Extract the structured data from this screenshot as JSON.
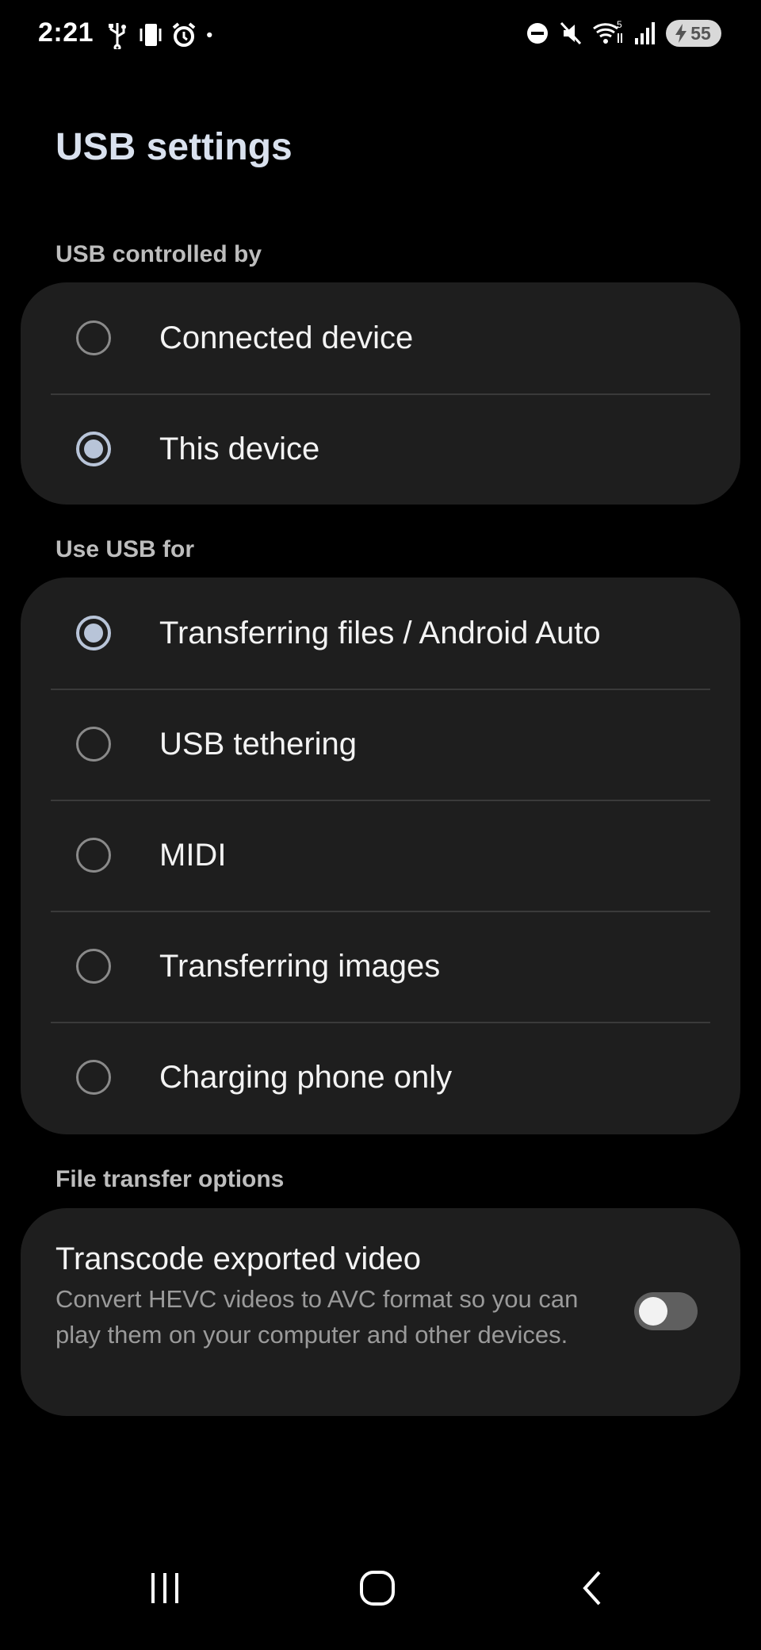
{
  "status": {
    "time": "2:21",
    "wifi_badge": "5",
    "battery_level": "55",
    "left_icons": [
      "usb-icon",
      "vibrate-icon",
      "alarm-icon",
      "dot-icon"
    ],
    "right_icons": [
      "do-not-disturb-icon",
      "mute-icon",
      "wifi-icon",
      "signal-icon",
      "battery-charging-icon"
    ]
  },
  "page": {
    "title": "USB settings"
  },
  "controlled_by": {
    "label": "USB controlled by",
    "options": [
      {
        "label": "Connected device",
        "checked": false
      },
      {
        "label": "This device",
        "checked": true
      }
    ]
  },
  "use_usb_for": {
    "label": "Use USB for",
    "options": [
      {
        "label": "Transferring files / Android Auto",
        "checked": true
      },
      {
        "label": "USB tethering",
        "checked": false
      },
      {
        "label": "MIDI",
        "checked": false
      },
      {
        "label": "Transferring images",
        "checked": false
      },
      {
        "label": "Charging phone only",
        "checked": false
      }
    ]
  },
  "file_transfer": {
    "label": "File transfer options",
    "title": "Transcode exported video",
    "description": "Convert HEVC videos to AVC format so you can play them on your computer and other devices.",
    "enabled": false
  },
  "nav": {
    "buttons": [
      "recents-icon",
      "home-icon",
      "back-icon"
    ]
  },
  "colors": {
    "background": "#000000",
    "card": "#1e1e1e",
    "accent": "#b8c4d8",
    "title": "#d9e1ee"
  }
}
